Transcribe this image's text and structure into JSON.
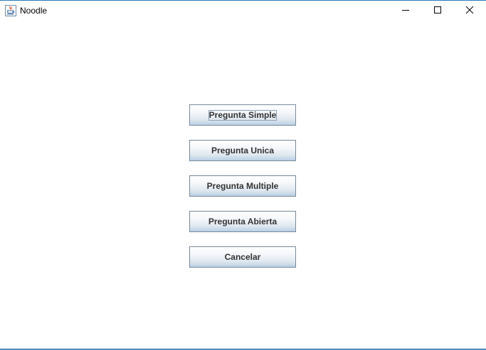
{
  "window": {
    "title": "Noodle",
    "app_icon": "java-coffee-cup-icon",
    "controls": {
      "minimize_icon": "minimize-icon",
      "maximize_icon": "maximize-icon",
      "close_icon": "close-icon"
    }
  },
  "menu": {
    "buttons": [
      {
        "label": "Pregunta Simple",
        "focused": true
      },
      {
        "label": "Pregunta Unica",
        "focused": false
      },
      {
        "label": "Pregunta Multiple",
        "focused": false
      },
      {
        "label": "Pregunta Abierta",
        "focused": false
      },
      {
        "label": "Cancelar",
        "focused": false
      }
    ]
  },
  "colors": {
    "title_border": "#2b79b7",
    "button_border": "#7a8a99",
    "button_text": "#333333"
  }
}
